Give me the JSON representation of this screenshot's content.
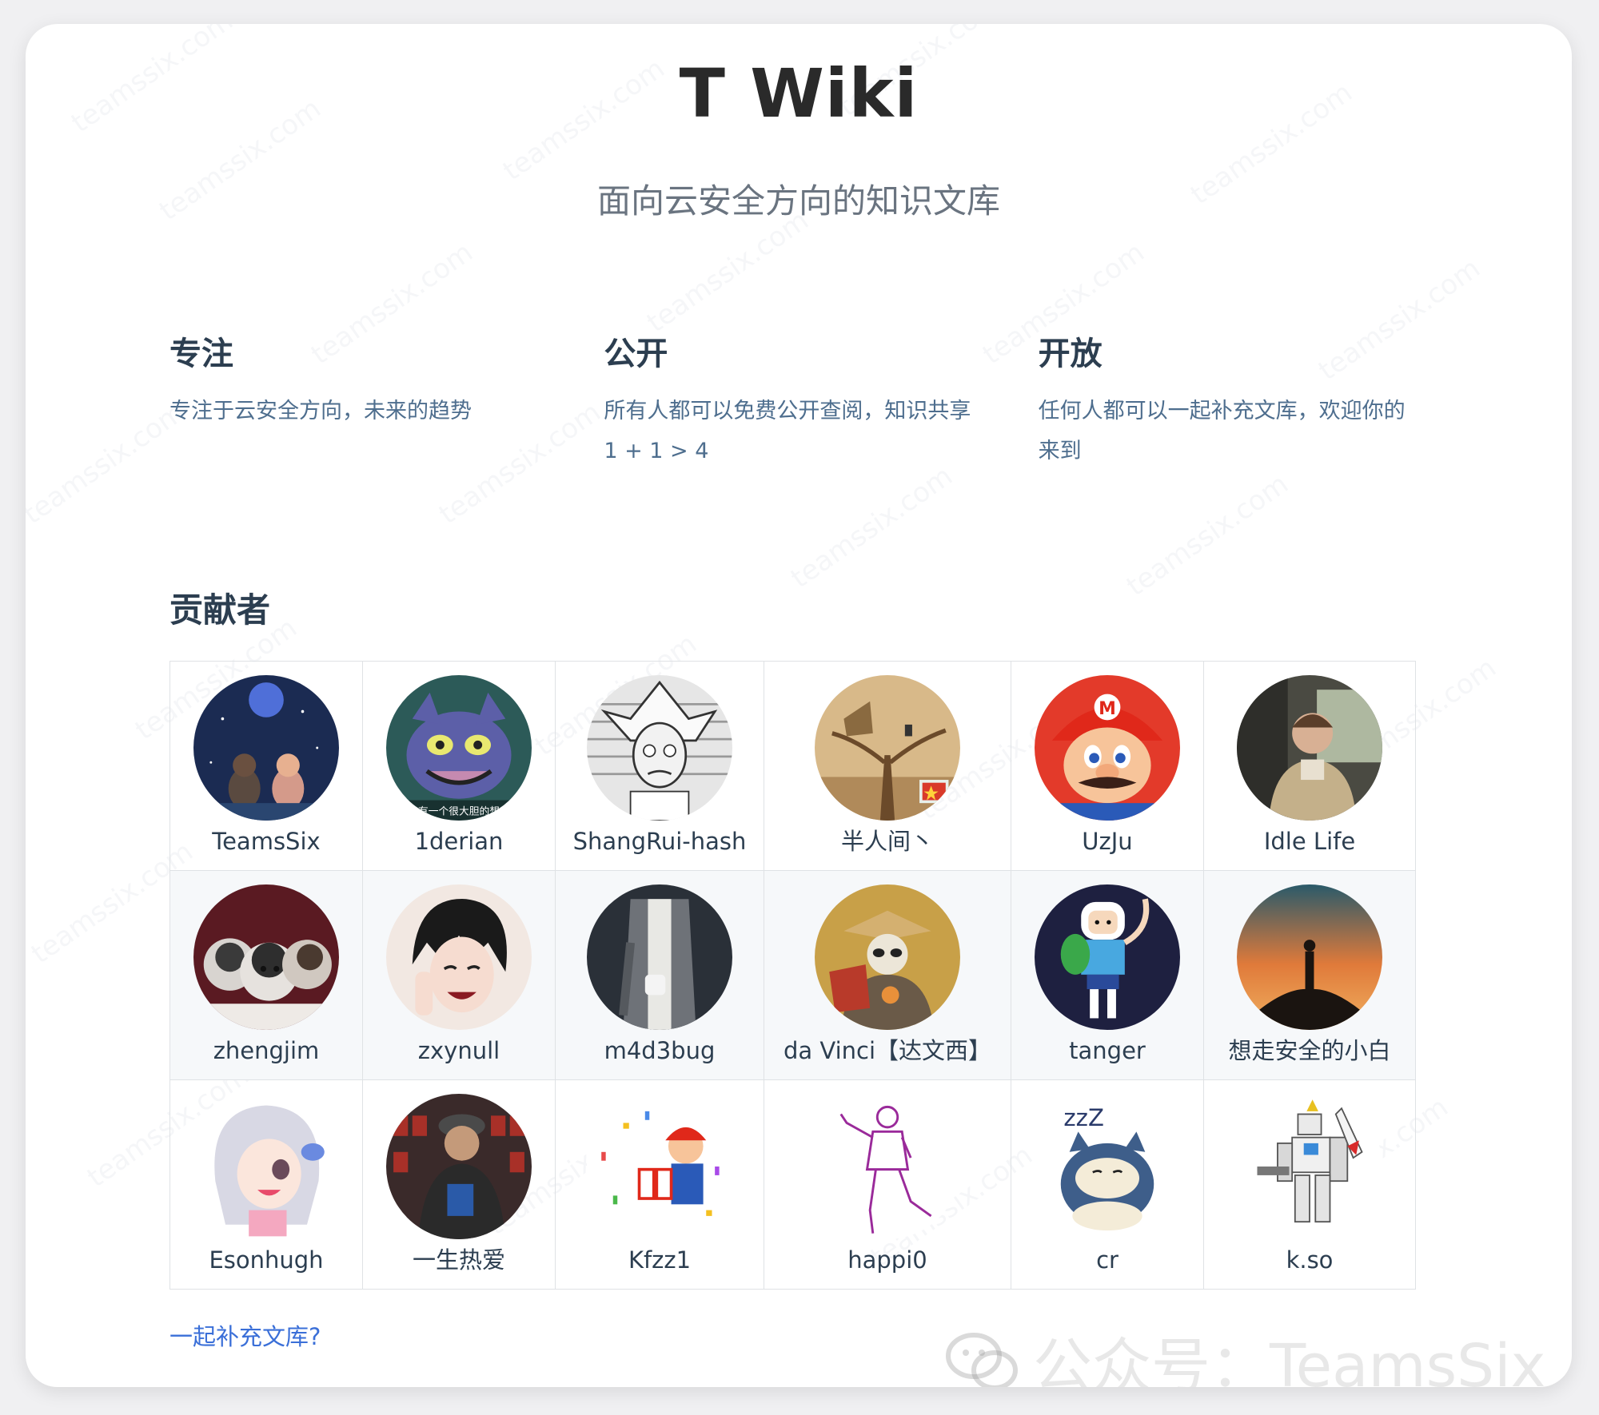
{
  "hero": {
    "title": "T Wiki",
    "description": "面向云安全方向的知识文库"
  },
  "features": [
    {
      "title": "专注",
      "details": "专注于云安全方向，未来的趋势"
    },
    {
      "title": "公开",
      "details": "所有人都可以免费公开查阅，知识共享 1 + 1 > 4"
    },
    {
      "title": "开放",
      "details": "任何人都可以一起补充文库，欢迎你的来到"
    }
  ],
  "contributors": {
    "title": "贡献者",
    "rows": [
      [
        {
          "name": "TeamsSix",
          "avatar": "night-sky-kids-avatar"
        },
        {
          "name": "1derian",
          "avatar": "cartoon-cat-avatar",
          "caption": "有一个很大胆的想"
        },
        {
          "name": "ShangRui-hash",
          "avatar": "sketch-scientist-avatar"
        },
        {
          "name": "半人间丶",
          "avatar": "treehouse-avatar"
        },
        {
          "name": "UzJu",
          "avatar": "plumber-avatar"
        },
        {
          "name": "Idle Life",
          "avatar": "man-on-train-avatar"
        }
      ],
      [
        {
          "name": "zhengjim",
          "avatar": "husky-puppies-avatar"
        },
        {
          "name": "zxynull",
          "avatar": "anime-boy-avatar"
        },
        {
          "name": "m4d3bug",
          "avatar": "person-cardigan-avatar"
        },
        {
          "name": "da Vinci【达文西】",
          "avatar": "panda-warrior-avatar"
        },
        {
          "name": "tanger",
          "avatar": "adventure-boy-avatar"
        },
        {
          "name": "想走安全的小白",
          "avatar": "sunset-silhouette-avatar"
        }
      ],
      [
        {
          "name": "Esonhugh",
          "avatar": "anime-girl-avatar"
        },
        {
          "name": "一生热爱",
          "avatar": "store-man-avatar"
        },
        {
          "name": "Kfzz1",
          "avatar": "plumber-gift-avatar"
        },
        {
          "name": "happi0",
          "avatar": "line-dancer-avatar"
        },
        {
          "name": "cr",
          "avatar": "sleepy-bear-avatar",
          "caption": "zzZ"
        },
        {
          "name": "k.so",
          "avatar": "mecha-robot-avatar"
        }
      ]
    ]
  },
  "join_link": "一起补充文库?",
  "watermark_text": "teamssix.com",
  "public_account": "公众号：TeamsSix",
  "colors": {
    "link": "#3a6fd8",
    "text": "#2c3e50",
    "muted": "#4e6e8e",
    "border": "#dfe2e5",
    "alt_row": "#f6f8fa"
  }
}
